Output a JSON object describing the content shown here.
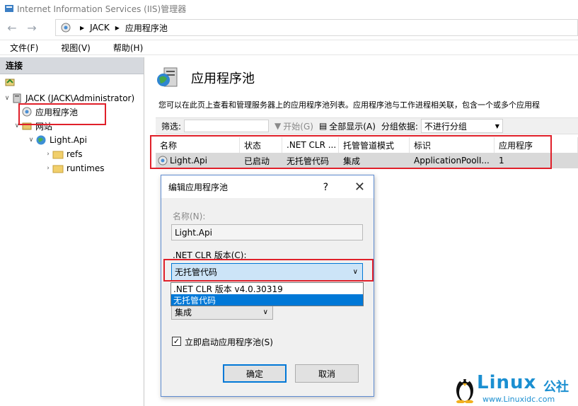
{
  "window": {
    "title": "Internet Information Services (IIS)管理器"
  },
  "address": {
    "segments": [
      "JACK",
      "应用程序池"
    ]
  },
  "menu": {
    "items": [
      "文件(F)",
      "视图(V)",
      "帮助(H)"
    ]
  },
  "connections": {
    "header": "连接",
    "tree": {
      "server": "JACK (JACK\\Administrator)",
      "app_pools": "应用程序池",
      "sites": "网站",
      "site": "Light.Api",
      "folders": [
        "refs",
        "runtimes"
      ]
    }
  },
  "main": {
    "title": "应用程序池",
    "description": "您可以在此页上查看和管理服务器上的应用程序池列表。应用程序池与工作进程相关联，包含一个或多个应用程",
    "filter": {
      "label": "筛选:",
      "start_label": "开始(G)",
      "show_all_label": "全部显示(A)",
      "group_label": "分组依据:",
      "group_value": "不进行分组"
    },
    "grid": {
      "headers": [
        "名称",
        "状态",
        ".NET CLR ...",
        "托管管道模式",
        "标识",
        "应用程序"
      ],
      "rows": [
        [
          "Light.Api",
          "已启动",
          "无托管代码",
          "集成",
          "ApplicationPoolI...",
          "1"
        ]
      ]
    }
  },
  "dialog": {
    "title": "编辑应用程序池",
    "help": "?",
    "name_label": "名称(N):",
    "name_value": "Light.Api",
    "clr_label": ".NET CLR 版本(C):",
    "clr_value": "无托管代码",
    "clr_options": [
      ".NET CLR 版本 v4.0.30319",
      "无托管代码"
    ],
    "pipeline_value": "集成",
    "start_checkbox_label": "立即启动应用程序池(S)",
    "start_checked": true,
    "ok_label": "确定",
    "cancel_label": "取消"
  },
  "watermark": {
    "brand": "Linux",
    "brand_cn": "公社",
    "url": "www.Linuxidc.com"
  },
  "colors": {
    "highlight_red": "#e0202a",
    "selection_blue": "#0078d7",
    "brand_blue": "#1b8fd1"
  }
}
